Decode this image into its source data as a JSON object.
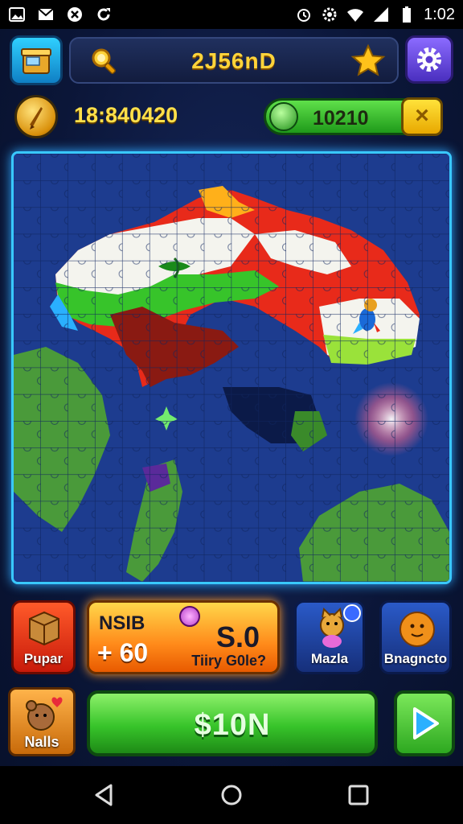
{
  "status_bar": {
    "time": "1:02",
    "left_icons": [
      "image-icon",
      "mail-icon",
      "notification-icon",
      "sync-icon"
    ],
    "right_icons": [
      "alarm-icon",
      "settings-status-icon",
      "wifi-icon",
      "signal-icon",
      "battery-icon"
    ]
  },
  "header": {
    "title": "2J56nD",
    "shop_icon": "shop-box-icon",
    "search_icon": "magnifier-icon",
    "star_icon": "star-icon",
    "settings_icon": "gear-icon"
  },
  "currency": {
    "coins": "18:840420",
    "gems": "10210",
    "add_label": "×"
  },
  "power_ups": {
    "pupar_label": "Pupar",
    "offer_line1": "NSIB",
    "offer_line2": "+ 60",
    "offer_value": "S.0",
    "offer_sub": "Tiiry G0le?",
    "mazla_label": "Mazla",
    "bnagncto_label": "Bnagncto"
  },
  "actions": {
    "nails_label": "Nalls",
    "main_label": "$10N",
    "play_icon": "play-icon"
  },
  "navigation": {
    "back_icon": "back-triangle-icon",
    "home_icon": "home-circle-icon",
    "recents_icon": "recents-square-icon"
  },
  "colors": {
    "board_water": "#1d3c8f",
    "board_border": "#39c8ff",
    "accent_gold": "#ffd43a",
    "accent_green": "#37c42a"
  }
}
